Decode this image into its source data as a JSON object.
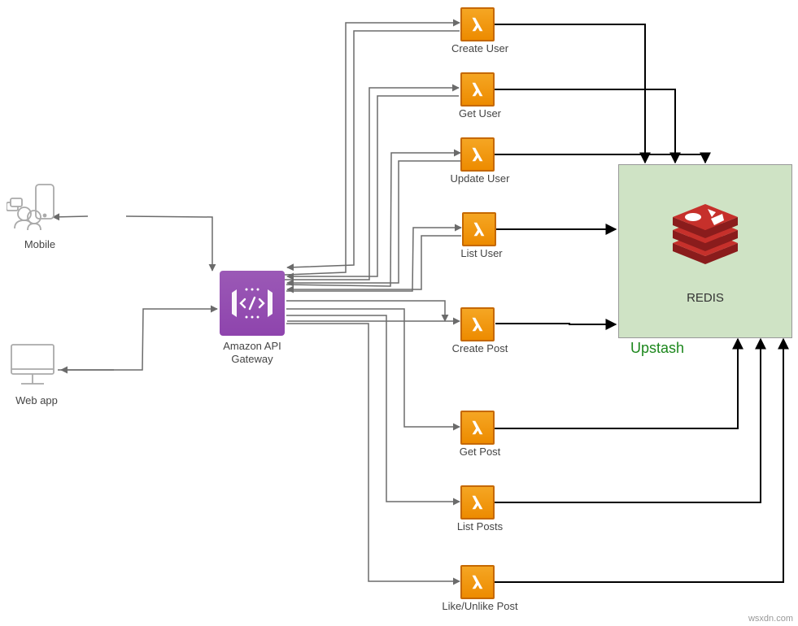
{
  "clients": {
    "mobile_label": "Mobile",
    "web_label": "Web app"
  },
  "api_gateway": {
    "label_line1": "Amazon API",
    "label_line2": "Gateway"
  },
  "lambdas": [
    {
      "id": "create-user",
      "label": "Create User"
    },
    {
      "id": "get-user",
      "label": "Get User"
    },
    {
      "id": "update-user",
      "label": "Update User"
    },
    {
      "id": "list-user",
      "label": "List User"
    },
    {
      "id": "create-post",
      "label": "Create Post"
    },
    {
      "id": "get-post",
      "label": "Get Post"
    },
    {
      "id": "list-posts",
      "label": "List Posts"
    },
    {
      "id": "like-unlike-post",
      "label": "Like/Unlike Post"
    }
  ],
  "redis": {
    "inner_label": "REDIS",
    "outer_label": "Upstash"
  },
  "watermark": "wsxdn.com"
}
